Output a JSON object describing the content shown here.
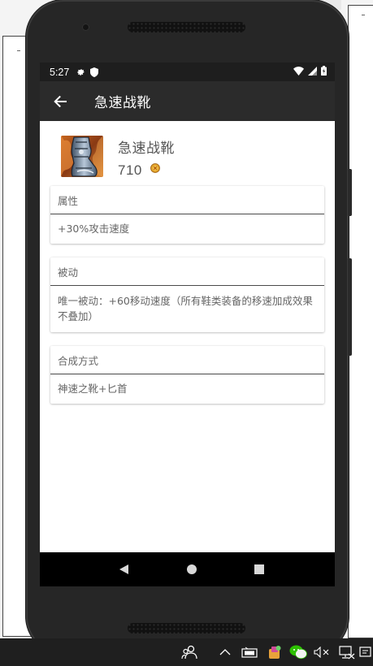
{
  "statusbar": {
    "time": "5:27",
    "icons": [
      "gear-icon",
      "shield-icon",
      "wifi-icon",
      "signal-icon",
      "battery-icon"
    ]
  },
  "appbar": {
    "title": "急速战靴",
    "back_icon": "arrow-left-icon"
  },
  "item": {
    "name": "急速战靴",
    "price": "710",
    "price_icon": "gold-coin-icon"
  },
  "sections": [
    {
      "title": "属性",
      "body": "+30%攻击速度"
    },
    {
      "title": "被动",
      "body": "唯一被动：+60移动速度（所有鞋类装备的移速加成效果不叠加）"
    },
    {
      "title": "合成方式",
      "body": "神速之靴+匕首"
    }
  ],
  "navbar": {
    "icons": [
      "back-triangle-icon",
      "home-circle-icon",
      "recents-square-icon"
    ]
  },
  "taskbar": {
    "icons": [
      "people-icon",
      "chevron-up-icon",
      "keyboard-icon",
      "app-icon",
      "wechat-icon",
      "speaker-muted-icon",
      "network-icon",
      "notification-icon"
    ]
  },
  "colors": {
    "appbar": "#2b2b2b",
    "statusbar": "#1e1e1e",
    "navbar": "#000000",
    "phone_body": "#262626",
    "taskbar": "#1f1f1f"
  }
}
